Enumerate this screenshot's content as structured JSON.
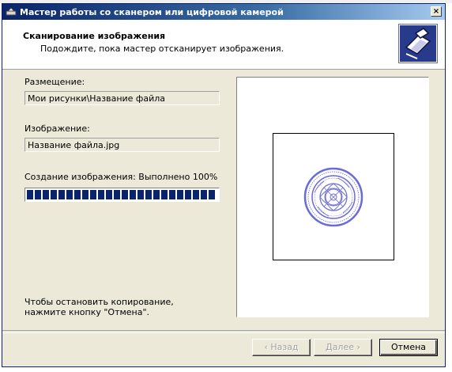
{
  "window": {
    "title": "Мастер работы со сканером или цифровой камерой",
    "close_label": "×"
  },
  "header": {
    "title": "Сканирование изображения",
    "subtitle": "Подождите, пока мастер отсканирует изображения."
  },
  "location": {
    "label": "Размещение:",
    "value": "Мои рисунки\\Название файла"
  },
  "image": {
    "label": "Изображение:",
    "value": "Название файла.jpg"
  },
  "progress": {
    "label": "Создание изображения: Выполнено 100%",
    "percent": 100
  },
  "note": "Чтобы остановить копирование, нажмите кнопку \"Отмена\".",
  "buttons": {
    "back": "‹ Назад",
    "next": "Далее ›",
    "cancel": "Отмена"
  },
  "colors": {
    "titlebar": "#0a246a",
    "progress_block": "#0a246a",
    "seal": "#6a6ad8"
  },
  "icons": {
    "title": "scanner-app-icon",
    "header": "scanner-wizard-icon",
    "preview": "round-seal-image"
  }
}
